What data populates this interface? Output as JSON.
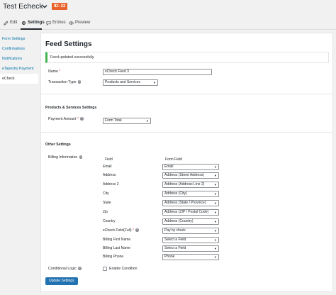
{
  "header": {
    "form_title": "Test Echeck",
    "id_badge": "ID: 22"
  },
  "toolbar": {
    "edit": "Edit",
    "settings": "Settings",
    "entries": "Entries",
    "preview": "Preview"
  },
  "sidebar": {
    "items": [
      {
        "label": "Form Settings"
      },
      {
        "label": "Confirmations"
      },
      {
        "label": "Notifications"
      },
      {
        "label": "eTapestry Payment"
      },
      {
        "label": "eCheck"
      }
    ]
  },
  "panel": {
    "title": "Feed Settings",
    "notice": "Feed updated successfully.",
    "name_label": "Name",
    "name_value": "eCheck Feed 3",
    "transaction_label": "Transaction Type",
    "transaction_value": "Products and Services",
    "products_section": "Products & Services Settings",
    "payment_amount_label": "Payment Amount",
    "payment_amount_value": "Form Total",
    "other_section": "Other Settings",
    "billing_label": "Billing Information",
    "col_field": "Field",
    "col_form_field": "Form Field",
    "mapping": [
      {
        "field": "Email",
        "value": "Email"
      },
      {
        "field": "Address",
        "value": "Address (Street Address)"
      },
      {
        "field": "Address 2",
        "value": "Address (Address Line 2)"
      },
      {
        "field": "City",
        "value": "Address (City)"
      },
      {
        "field": "State",
        "value": "Address (State / Province)"
      },
      {
        "field": "Zip",
        "value": "Address (ZIP / Postal Code)"
      },
      {
        "field": "Country",
        "value": "Address (Country)"
      },
      {
        "field": "eCheck Field(Full)",
        "value": "Pay by check"
      },
      {
        "field": "Billing First Name",
        "value": "Select a Field"
      },
      {
        "field": "Billing Last Name",
        "value": "Select a Field"
      },
      {
        "field": "Billing Phone",
        "value": "Phone"
      }
    ],
    "conditional_label": "Conditional Logic",
    "enable_condition": "Enable Condition",
    "update_button": "Update Settings"
  }
}
